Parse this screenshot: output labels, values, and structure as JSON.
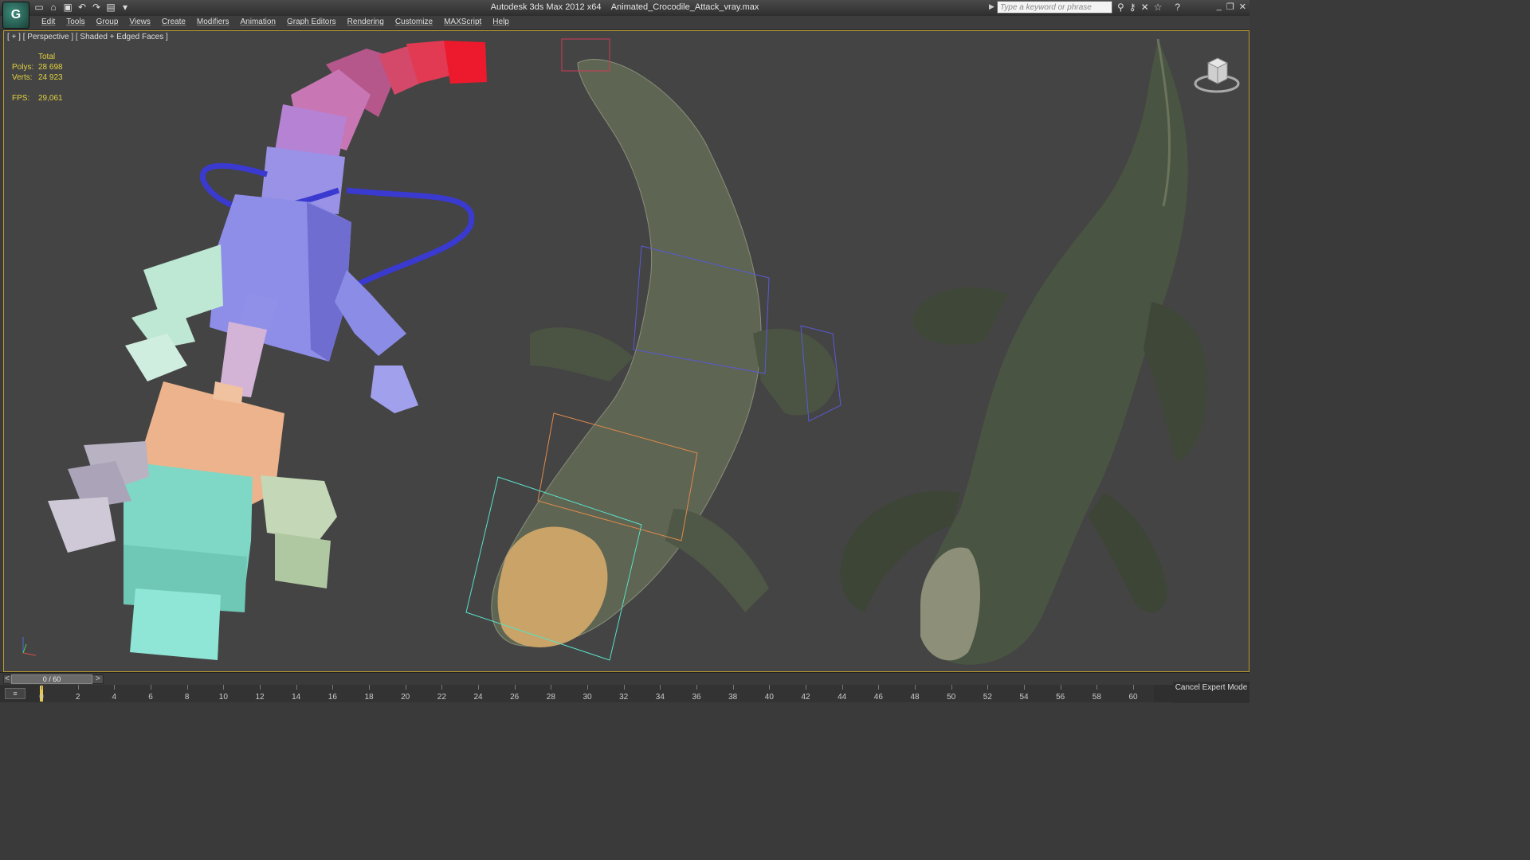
{
  "window": {
    "app_name": "Autodesk 3ds Max  2012 x64",
    "file_name": "Animated_Crocodile_Attack_vray.max",
    "search_placeholder": "Type a keyword or phrase"
  },
  "menu": [
    "Edit",
    "Tools",
    "Group",
    "Views",
    "Create",
    "Modifiers",
    "Animation",
    "Graph Editors",
    "Rendering",
    "Customize",
    "MAXScript",
    "Help"
  ],
  "viewport": {
    "label": "[ + ] [ Perspective ] [ Shaded + Edged Faces ]",
    "stats": {
      "total_label": "Total",
      "polys_label": "Polys:",
      "polys": "28 698",
      "verts_label": "Verts:",
      "verts": "24 923",
      "fps_label": "FPS:",
      "fps": "29,061"
    }
  },
  "time_slider": {
    "value": "0 / 60",
    "prev": "<",
    "next": ">"
  },
  "timeline": {
    "ticks": [
      "0",
      "2",
      "4",
      "6",
      "8",
      "10",
      "12",
      "14",
      "16",
      "18",
      "20",
      "22",
      "24",
      "26",
      "28",
      "30",
      "32",
      "34",
      "36",
      "38",
      "40",
      "42",
      "44",
      "46",
      "48",
      "50",
      "52",
      "54",
      "56",
      "58",
      "60"
    ]
  },
  "status": {
    "cancel_expert_mode": "Cancel Expert Mode"
  },
  "colors": {
    "viewport_border": "#b89a30",
    "stats_text": "#e0d040",
    "viewport_bg": "#444444"
  }
}
